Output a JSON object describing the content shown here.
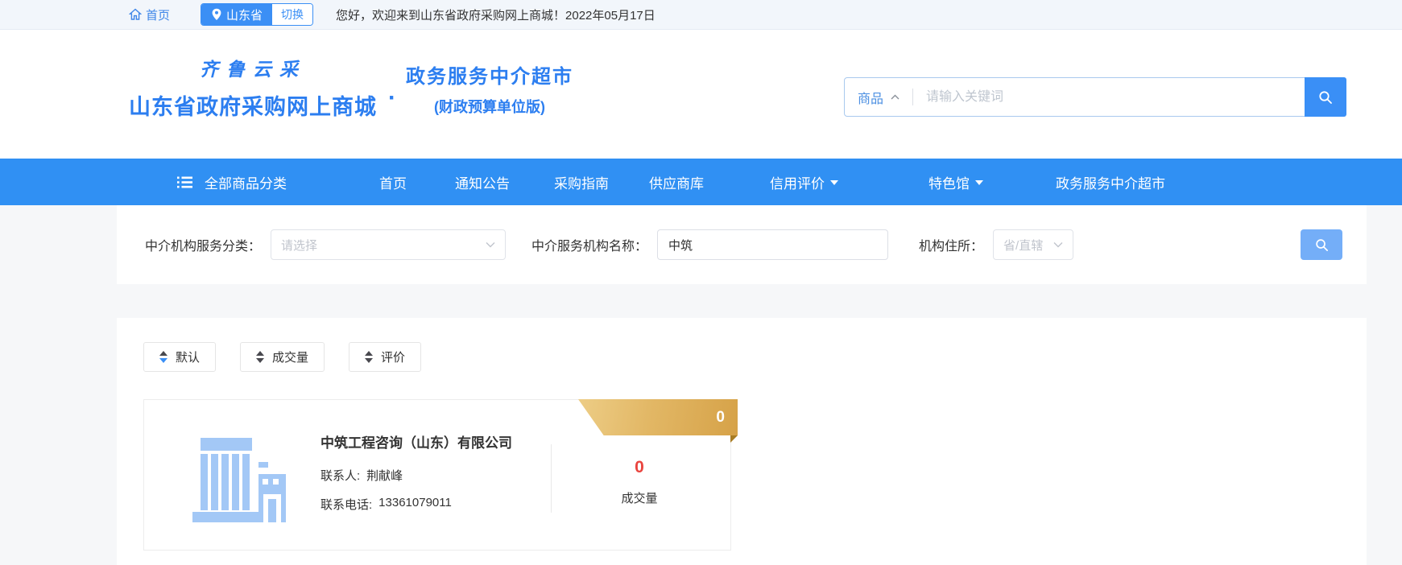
{
  "topbar": {
    "home": "首页",
    "region": "山东省",
    "switch_label": "切换",
    "welcome": "您好，欢迎来到山东省政府采购网上商城！2022年05月17日"
  },
  "header": {
    "brand_script": "齐鲁云采",
    "brand_main": "山东省政府采购网上商城",
    "brand_dot": "·",
    "brand_sub_title": "政务服务中介超市",
    "brand_sub_note": "(财政预算单位版)",
    "search": {
      "category": "商品",
      "placeholder": "请输入关键词"
    }
  },
  "navbar": {
    "all_categories": "全部商品分类",
    "items": [
      {
        "label": "首页"
      },
      {
        "label": "通知公告"
      },
      {
        "label": "采购指南"
      },
      {
        "label": "供应商库"
      },
      {
        "label": "信用评价"
      },
      {
        "label": "特色馆"
      },
      {
        "label": "政务服务中介超市"
      }
    ]
  },
  "filters": {
    "category_label": "中介机构服务分类：",
    "category_placeholder": "请选择",
    "name_label": "中介服务机构名称：",
    "name_value": "中筑",
    "location_label": "机构住所：",
    "location_value": "省/直辖"
  },
  "sort": {
    "options": [
      {
        "label": "默认"
      },
      {
        "label": "成交量"
      },
      {
        "label": "评价"
      }
    ]
  },
  "result": {
    "company": "中筑工程咨询（山东）有限公司",
    "contact_label": "联系人:",
    "contact_name": "荆献峰",
    "phone_label": "联系电话:",
    "phone": "13361079011",
    "deals_count": "0",
    "deals_label": "成交量",
    "ribbon_count": "0"
  },
  "colors": {
    "primary_blue": "#3090f3",
    "link_blue": "#3e86e8",
    "light_button_blue": "#74aef8",
    "ribbon_gold": "#ddab54",
    "count_red": "#e9443e",
    "building_icon_blue": "#a3c8f6"
  }
}
